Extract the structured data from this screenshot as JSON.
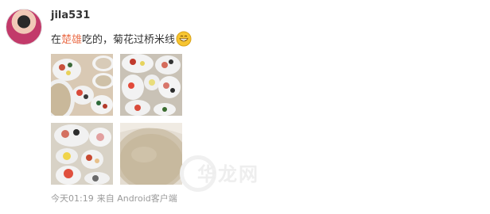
{
  "user": {
    "name": "jila531"
  },
  "post": {
    "prefix": "在",
    "link_text": "楚雄",
    "suffix": "吃的，菊花过桥米线"
  },
  "meta": {
    "time": "今天01:19",
    "source": "来自 Android客户端"
  },
  "watermark": {
    "text": "华龙网"
  },
  "icons": {
    "emoji": "grinning-emoji-icon"
  },
  "colors": {
    "link": "#eb7350",
    "text": "#333333",
    "meta": "#9a9a9a"
  }
}
